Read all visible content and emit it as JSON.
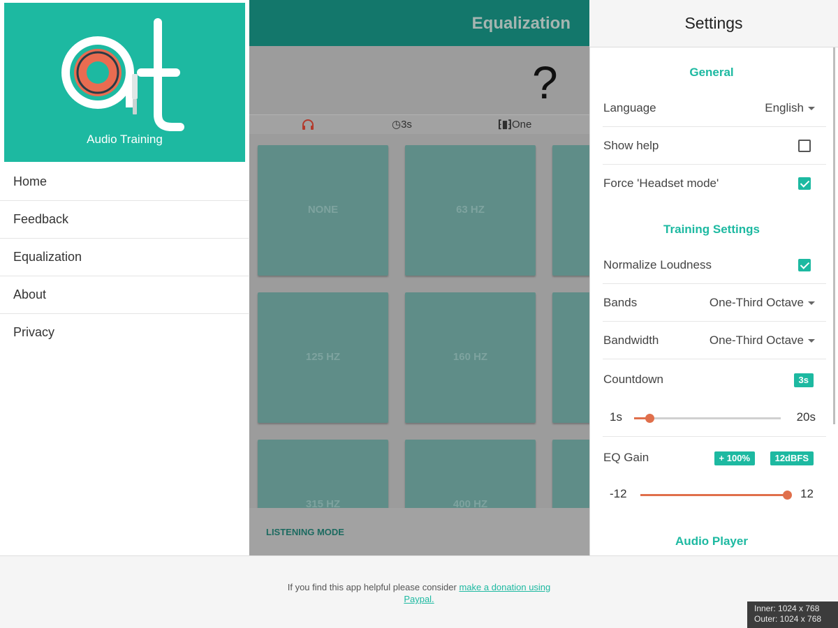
{
  "drawer": {
    "logo_caption": "Audio Training",
    "menu": [
      "Home",
      "Feedback",
      "Equalization",
      "About",
      "Privacy"
    ]
  },
  "main": {
    "title": "Equalization",
    "question": "?",
    "tabs": {
      "timer": "3s",
      "mode": "One"
    },
    "tiles": [
      "NONE",
      "63 HZ",
      "125 HZ",
      "160 HZ",
      "315 HZ",
      "400 HZ"
    ],
    "listening_mode": "LISTENING MODE"
  },
  "settings": {
    "title": "Settings",
    "general_header": "General",
    "language_label": "Language",
    "language_value": "English",
    "show_help_label": "Show help",
    "show_help_checked": false,
    "headset_label": "Force 'Headset mode'",
    "headset_checked": true,
    "training_header": "Training Settings",
    "normalize_label": "Normalize Loudness",
    "normalize_checked": true,
    "bands_label": "Bands",
    "bands_value": "One-Third Octave",
    "bandwidth_label": "Bandwidth",
    "bandwidth_value": "One-Third Octave",
    "countdown_label": "Countdown",
    "countdown_badge": "3s",
    "countdown_min": "1s",
    "countdown_max": "20s",
    "countdown_value": 3,
    "countdown_range": [
      1,
      20
    ],
    "eqgain_label": "EQ Gain",
    "eqgain_badge1": "+ 100%",
    "eqgain_badge2": "12dBFS",
    "eqgain_min": "-12",
    "eqgain_max": "12",
    "eqgain_value": 12,
    "eqgain_range": [
      -12,
      12
    ],
    "audio_header": "Audio Player"
  },
  "footer": {
    "text": "If you find this app helpful please consider ",
    "link": "make a donation using Paypal."
  },
  "viewport": {
    "inner": "Inner: 1024 x 768",
    "outer": "Outer: 1024 x 768"
  },
  "colors": {
    "accent": "#1db9a1",
    "appbar": "#13776b",
    "slider": "#e06f4b"
  }
}
